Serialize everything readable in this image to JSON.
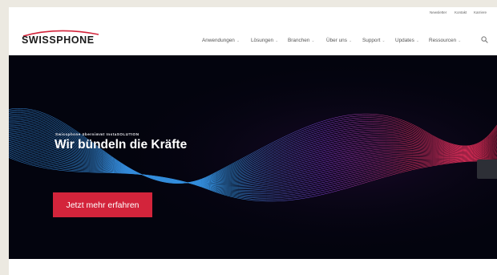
{
  "topbar": {
    "links": [
      "Newsletter",
      "Kontakt",
      "Karriere"
    ]
  },
  "brand": {
    "logo_text": "SWISSPHONE",
    "accent": "#d3243b"
  },
  "nav": {
    "items": [
      {
        "label": "Anwendungen"
      },
      {
        "label": "Lösungen"
      },
      {
        "label": "Branchen"
      },
      {
        "label": "Über uns"
      },
      {
        "label": "Support"
      },
      {
        "label": "Updates"
      },
      {
        "label": "Ressourcen"
      }
    ],
    "chevron_icon": "chevron-down-icon",
    "search_icon": "search-icon"
  },
  "hero": {
    "kicker": "Swissphone übernimmt InstaSOLUTION",
    "headline": "Wir bündeln die Kräfte",
    "cta_label": "Jetzt mehr erfahren",
    "background": "#03040e"
  }
}
